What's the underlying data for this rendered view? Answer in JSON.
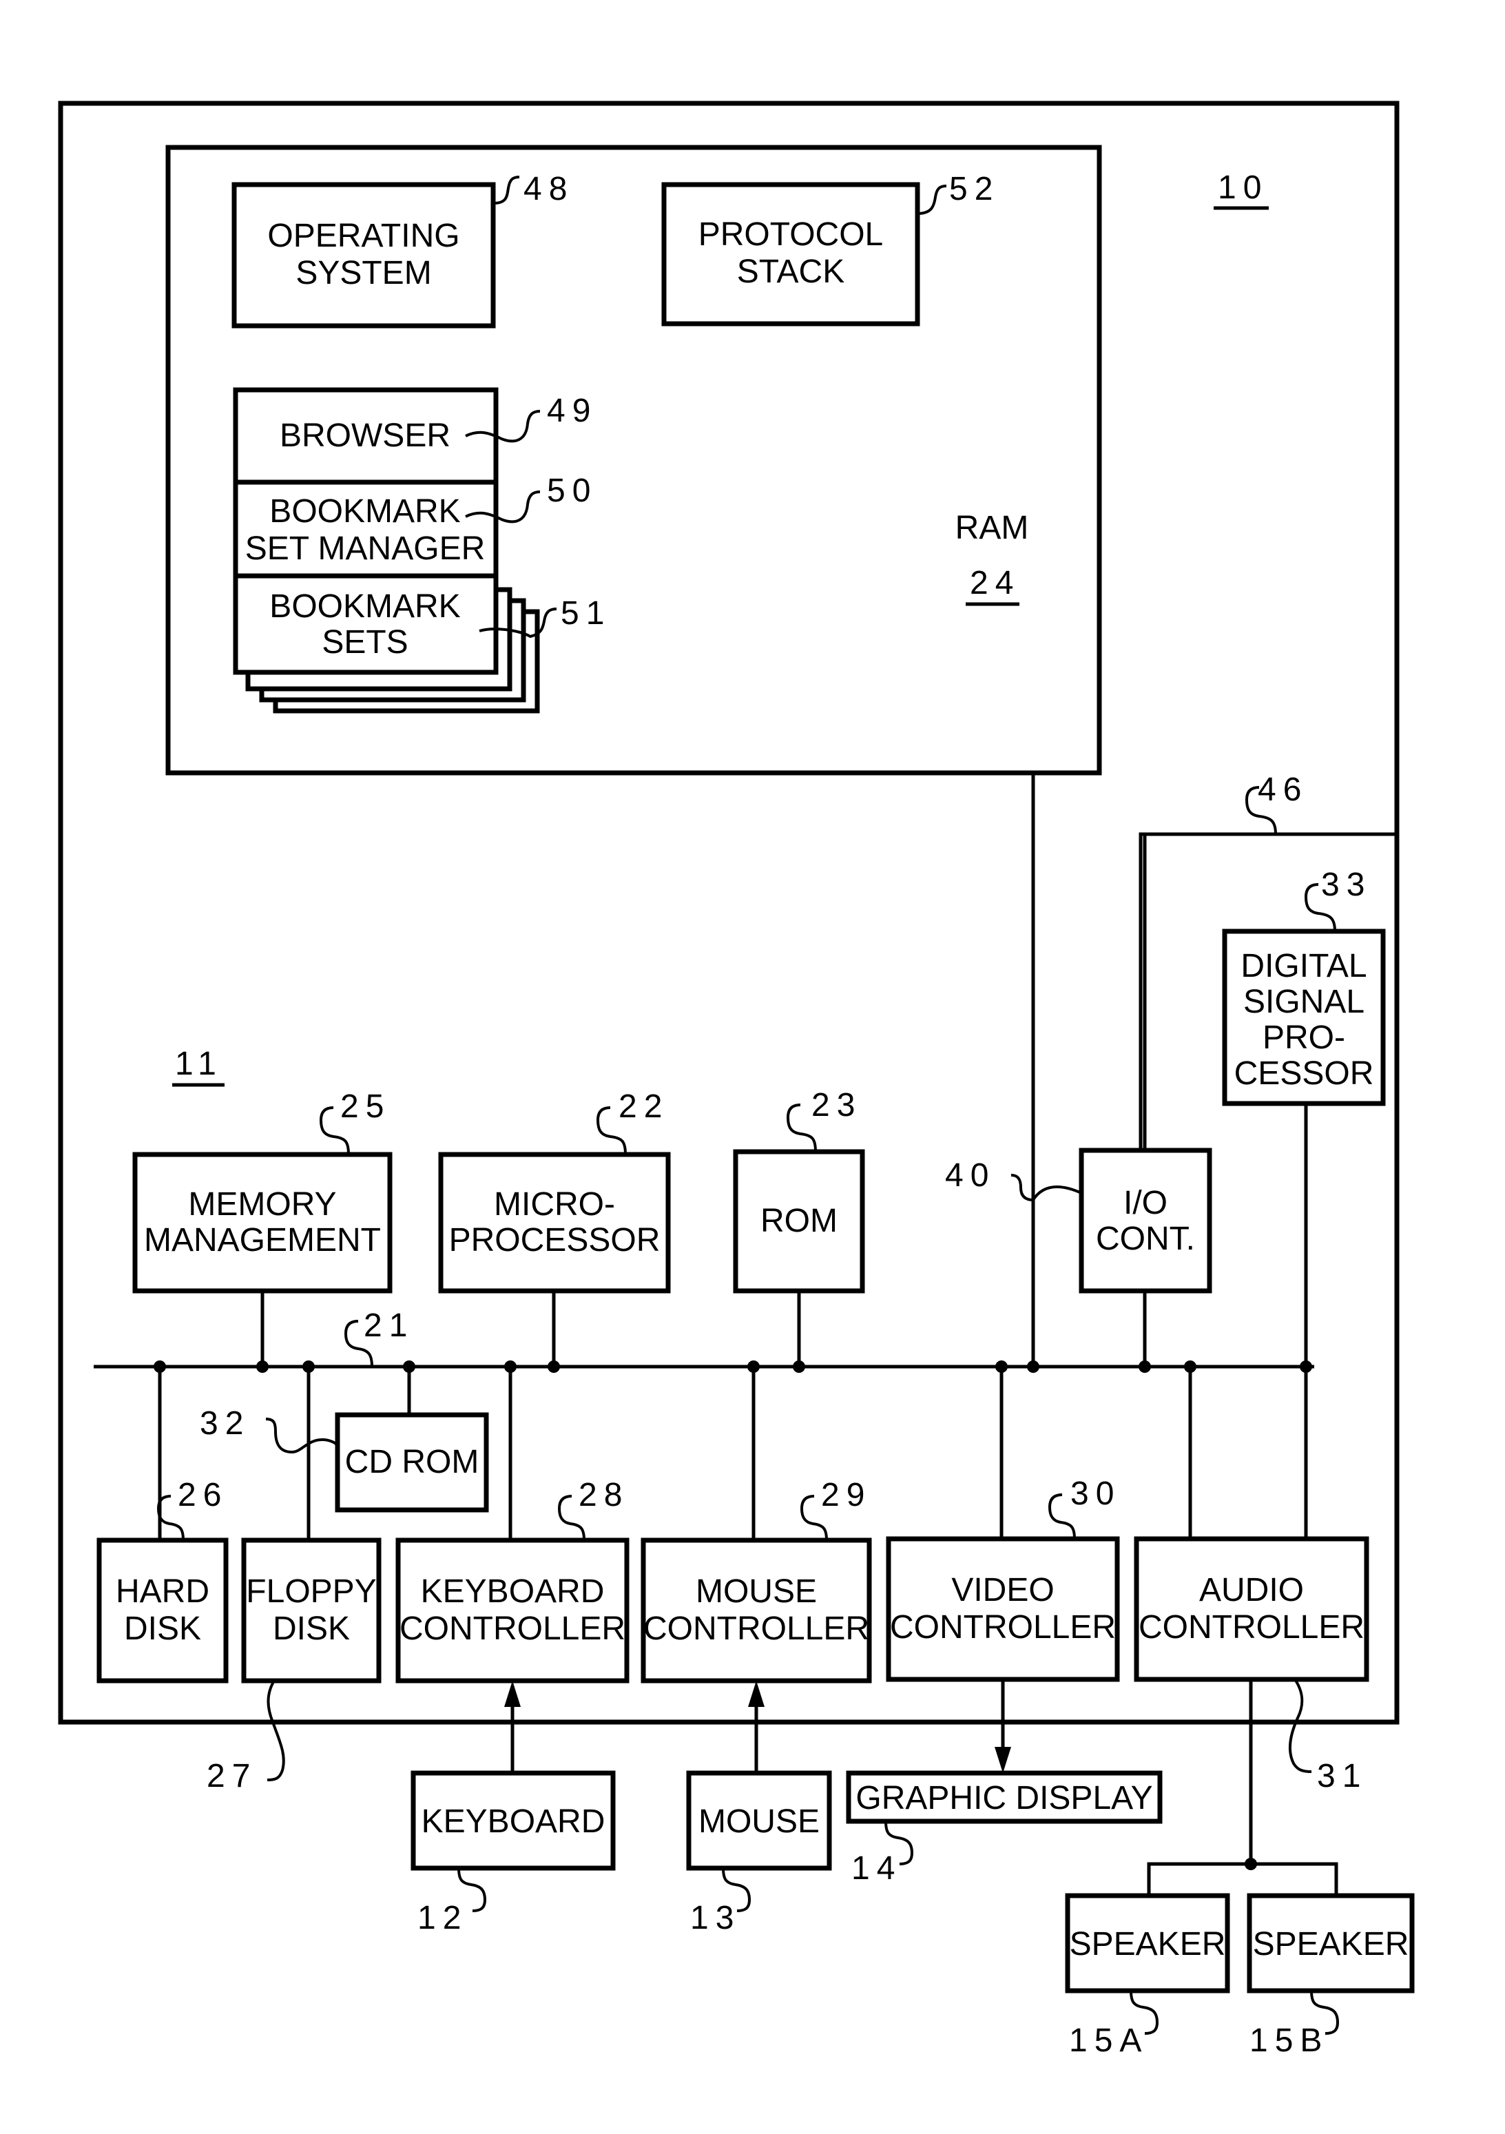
{
  "figure": {
    "system_ref": "10",
    "board_ref": "11",
    "ram": {
      "label": "RAM",
      "ref": "24"
    },
    "ram_contents": {
      "operating_system": {
        "lines": [
          "OPERATING",
          "SYSTEM"
        ],
        "ref": "48"
      },
      "protocol_stack": {
        "lines": [
          "PROTOCOL",
          "STACK"
        ],
        "ref": "52"
      },
      "browser": {
        "lines": [
          "BROWSER"
        ],
        "ref": "49"
      },
      "bookmark_set_manager": {
        "lines": [
          "BOOKMARK",
          "SET MANAGER"
        ],
        "ref": "50"
      },
      "bookmark_sets": {
        "lines": [
          "BOOKMARK",
          "SETS"
        ],
        "ref": "51"
      }
    },
    "dsp_group_ref": "46",
    "dsp": {
      "lines": [
        "DIGITAL",
        "SIGNAL",
        "PRO-",
        "CESSOR"
      ],
      "ref": "33"
    },
    "bus_ref": "21",
    "top_row": [
      {
        "id": "memory-management",
        "lines": [
          "MEMORY",
          "MANAGEMENT"
        ],
        "ref": "25"
      },
      {
        "id": "microprocessor",
        "lines": [
          "MICRO-",
          "PROCESSOR"
        ],
        "ref": "22"
      },
      {
        "id": "rom",
        "lines": [
          "ROM"
        ],
        "ref": "23"
      },
      {
        "id": "io-controller",
        "lines": [
          "I/O",
          "CONT."
        ],
        "ref": "40"
      }
    ],
    "cd_rom": {
      "lines": [
        "CD ROM"
      ],
      "ref": "32"
    },
    "bottom_row": [
      {
        "id": "hard-disk",
        "lines": [
          "HARD",
          "DISK"
        ],
        "ref": "26"
      },
      {
        "id": "floppy-disk",
        "lines": [
          "FLOPPY",
          "DISK"
        ],
        "ref": "27"
      },
      {
        "id": "keyboard-controller",
        "lines": [
          "KEYBOARD",
          "CONTROLLER"
        ],
        "ref": "28"
      },
      {
        "id": "mouse-controller",
        "lines": [
          "MOUSE",
          "CONTROLLER"
        ],
        "ref": "29"
      },
      {
        "id": "video-controller",
        "lines": [
          "VIDEO",
          "CONTROLLER"
        ],
        "ref": "30"
      },
      {
        "id": "audio-controller",
        "lines": [
          "AUDIO",
          "CONTROLLER"
        ],
        "ref": "31"
      }
    ],
    "peripherals": [
      {
        "id": "keyboard",
        "lines": [
          "KEYBOARD"
        ],
        "ref": "12"
      },
      {
        "id": "mouse",
        "lines": [
          "MOUSE"
        ],
        "ref": "13"
      },
      {
        "id": "graphic-display",
        "lines": [
          "GRAPHIC DISPLAY"
        ],
        "ref": "14"
      },
      {
        "id": "speaker-a",
        "lines": [
          "SPEAKER"
        ],
        "ref": "15A"
      },
      {
        "id": "speaker-b",
        "lines": [
          "SPEAKER"
        ],
        "ref": "15B"
      }
    ]
  }
}
